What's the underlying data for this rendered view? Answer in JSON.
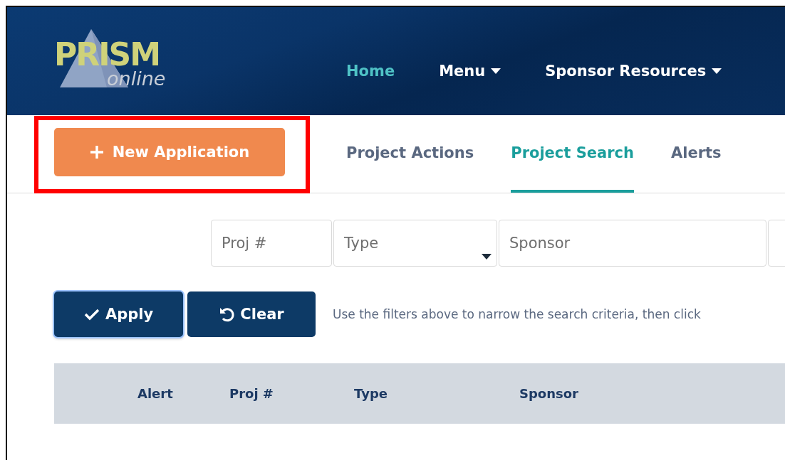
{
  "logo": {
    "name": "PRISM",
    "tagline": "online"
  },
  "nav": [
    {
      "label": "Home",
      "selected": true,
      "dropdown": false
    },
    {
      "label": "Menu",
      "selected": false,
      "dropdown": true
    },
    {
      "label": "Sponsor Resources",
      "selected": false,
      "dropdown": true
    }
  ],
  "new_button": {
    "label": "New Application",
    "highlighted": true
  },
  "tabs": [
    {
      "label": "Project Actions",
      "selected": false
    },
    {
      "label": "Project Search",
      "selected": true
    },
    {
      "label": "Alerts",
      "selected": false
    }
  ],
  "filters": [
    {
      "kind": "text",
      "placeholder": "Proj #"
    },
    {
      "kind": "select",
      "placeholder": "Type"
    },
    {
      "kind": "text",
      "placeholder": "Sponsor"
    },
    {
      "kind": "text"
    }
  ],
  "actions": [
    {
      "kind": "apply",
      "label": "Apply",
      "focused": true
    },
    {
      "kind": "clear",
      "label": "Clear",
      "focused": false
    }
  ],
  "hint": "Use the filters above to narrow the search criteria, then click",
  "table": {
    "columns": [
      "Alert",
      "Proj #",
      "Type",
      "Sponsor"
    ]
  }
}
